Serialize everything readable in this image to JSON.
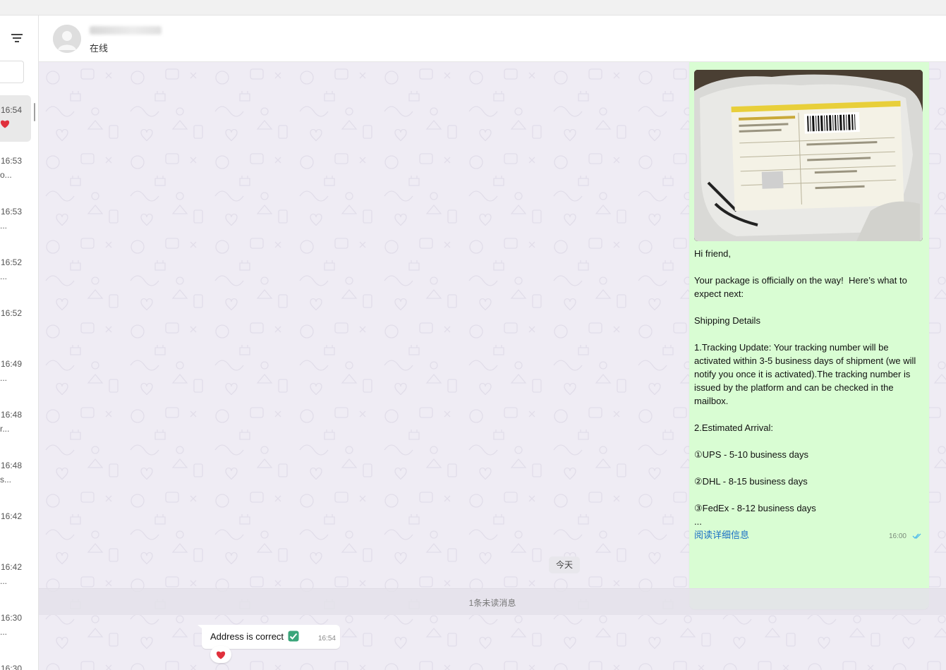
{
  "header": {
    "contact_status": "在线"
  },
  "sidebar": {
    "chats": [
      {
        "time": "16:54",
        "preview": "",
        "reaction": "heart-icon",
        "active": true
      },
      {
        "time": "16:53",
        "preview": "o..."
      },
      {
        "time": "16:53",
        "preview": "..."
      },
      {
        "time": "16:52",
        "preview": "..."
      },
      {
        "time": "16:52",
        "preview": ""
      },
      {
        "time": "16:49",
        "preview": "..."
      },
      {
        "time": "16:48",
        "preview": "r..."
      },
      {
        "time": "16:48",
        "preview": "s..."
      },
      {
        "time": "16:42",
        "preview": ""
      },
      {
        "time": "16:42",
        "preview": "..."
      },
      {
        "time": "16:30",
        "preview": "..."
      },
      {
        "time": "16:30",
        "preview": ""
      }
    ]
  },
  "messages": {
    "outgoing": {
      "text": "Hi friend,\n\nYour package is officially on the way!  Here’s what to expect next:\n\nShipping Details\n\n1.Tracking Update: Your tracking number will be activated within 3-5 business days of shipment (we will notify you once it is activated).The tracking number is issued by the platform and can be checked in the mailbox.\n\n2.Estimated Arrival:\n\n①UPS - 5-10 business days\n\n②DHL - 8-15 business days\n\n③FedEx - 8-12 business days\n...",
      "read_more": "阅读详细信息",
      "time": "16:00",
      "status_icon": "double-check-icon"
    },
    "date_divider": "今天",
    "unread_divider": "1条未读消息",
    "incoming": {
      "text": "Address is correct",
      "emoji": "check-mark-button-emoji",
      "time": "16:54",
      "reaction": "heart-icon"
    }
  },
  "colors": {
    "outgoing_bubble": "#d9fdd3",
    "incoming_bubble": "#ffffff",
    "chat_background": "#efecf4",
    "link": "#1a6fc4",
    "read_ticks": "#53bdeb"
  }
}
